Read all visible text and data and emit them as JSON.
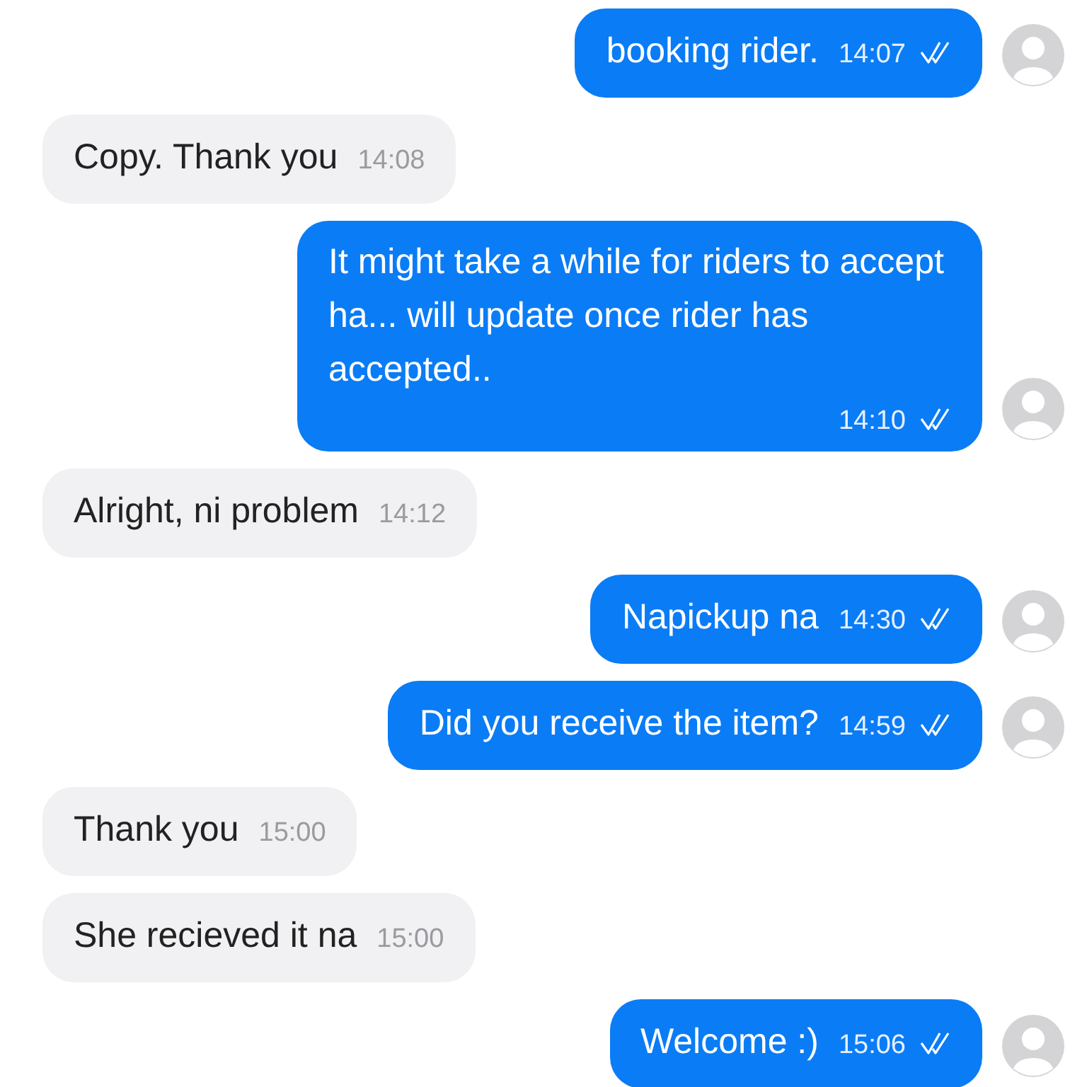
{
  "messages": [
    {
      "kind": "sent",
      "text": "booking rider.",
      "time": "14:07"
    },
    {
      "kind": "received",
      "text": "Copy. Thank you",
      "time": "14:08"
    },
    {
      "kind": "sent",
      "text": "It might take a while for riders to accept ha... will update once rider has accepted..",
      "time": "14:10"
    },
    {
      "kind": "received",
      "text": "Alright, ni problem",
      "time": "14:12"
    },
    {
      "kind": "sent",
      "text": "Napickup na",
      "time": "14:30"
    },
    {
      "kind": "sent",
      "text": "Did you receive the item?",
      "time": "14:59"
    },
    {
      "kind": "received",
      "text": "Thank you",
      "time": "15:00"
    },
    {
      "kind": "received",
      "text": "She recieved it na",
      "time": "15:00"
    },
    {
      "kind": "sent",
      "text": "Welcome :)",
      "time": "15:06"
    }
  ]
}
